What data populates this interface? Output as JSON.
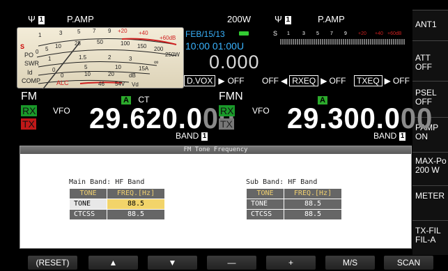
{
  "main": {
    "antenna_icon": "antenna-signal-icon",
    "ant_number": "1",
    "preamp": "P.AMP",
    "meter_labels": {
      "s": "S",
      "po": "PO",
      "swr": "SWR",
      "id": "Id",
      "comp": "COMP",
      "alc": "ALC",
      "scale_s": [
        "1",
        "3",
        "5",
        "7",
        "9",
        "+20",
        "+40",
        "+60dB"
      ],
      "scale_po": [
        "0",
        "5",
        "10",
        "25",
        "50",
        "100",
        "150",
        "200",
        "250W"
      ],
      "scale_swr": [
        "1",
        "1.5",
        "2",
        "3",
        "∞"
      ],
      "scale_id": [
        "0",
        "5",
        "10",
        "15A"
      ],
      "scale_comp": [
        "0",
        "10",
        "20",
        "dB"
      ],
      "scale_vd": [
        "46",
        "54V",
        "Vd"
      ]
    },
    "mode": "FM",
    "vfo_label": "VFO",
    "rx": "RX",
    "tx": "TX",
    "a_badge": "A",
    "ct": "CT",
    "freq_main": "29.620.0",
    "freq_dim": "00",
    "band_label": "BAND",
    "band_num": "1"
  },
  "center": {
    "power": "200W",
    "date": "FEB/15/13",
    "time": "10:00 01:00U",
    "value": "0.000",
    "dvox": "D.VOX",
    "dvox_state": "OFF",
    "off_label": "OFF",
    "rxeq": "RXEQ",
    "rxeq_state": "OFF",
    "txeq": "TXEQ",
    "txeq_state": "OFF"
  },
  "sub": {
    "ant_number": "1",
    "preamp": "P.AMP",
    "s_scale": [
      "S",
      "1",
      "3",
      "5",
      "7",
      "9",
      "+20",
      "+40",
      "+60dB"
    ],
    "mode": "FMN",
    "vfo_label": "VFO",
    "rx": "RX",
    "tx": "TX",
    "a_badge": "A",
    "freq_main": "29.300.0",
    "freq_dim": "00",
    "band_label": "BAND",
    "band_num": "1"
  },
  "softkeys": [
    {
      "label": "ANT1"
    },
    {
      "label": "ATT\nOFF"
    },
    {
      "label": "PSEL\nOFF"
    },
    {
      "label": "PAMP\nON"
    },
    {
      "label": "MAX-Po\n200 W"
    },
    {
      "label": "METER"
    },
    {
      "label": "TX-FIL\nFIL-A"
    }
  ],
  "dialog": {
    "title": "FM Tone Frequency",
    "main_band_title": "Main Band: HF Band",
    "sub_band_title": "Sub Band: HF Band",
    "col_tone": "TONE",
    "col_freq": "FREQ.[Hz]",
    "main_rows": [
      {
        "name": "TONE",
        "freq": "88.5"
      },
      {
        "name": "CTCSS",
        "freq": "88.5"
      }
    ],
    "sub_rows": [
      {
        "name": "TONE",
        "freq": "88.5"
      },
      {
        "name": "CTCSS",
        "freq": "88.5"
      }
    ]
  },
  "bottom_keys": [
    {
      "label": "(RESET)"
    },
    {
      "label": "▲"
    },
    {
      "label": "▼"
    },
    {
      "label": "—"
    },
    {
      "label": "+"
    },
    {
      "label": "M/S"
    },
    {
      "label": "SCAN"
    }
  ],
  "colors": {
    "accent_blue": "#3ab4ff",
    "rx_green": "#1a9a2a",
    "tx_red": "#c01818",
    "selected_yellow": "#f2d46a"
  }
}
